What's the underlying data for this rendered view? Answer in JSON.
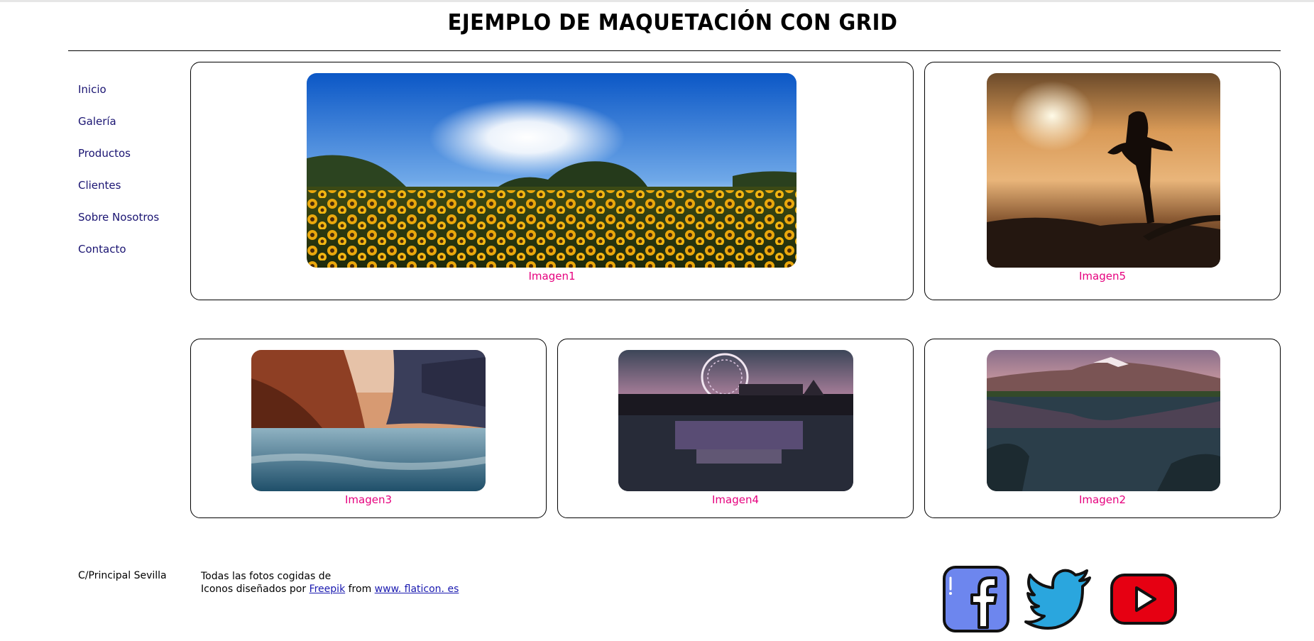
{
  "header": {
    "title": "EJEMPLO DE MAQUETACIÓN CON GRID"
  },
  "sidebar": {
    "items": [
      {
        "label": "Inicio"
      },
      {
        "label": "Galería"
      },
      {
        "label": "Productos"
      },
      {
        "label": "Clientes"
      },
      {
        "label": "Sobre Nosotros"
      },
      {
        "label": "Contacto"
      }
    ]
  },
  "gallery": {
    "caption_color": "#e6007e",
    "cards": [
      {
        "caption": "Imagen1",
        "subject": "sunflower-field"
      },
      {
        "caption": "Imagen5",
        "subject": "sunset-silhouette"
      },
      {
        "caption": "Imagen3",
        "subject": "canyon-river"
      },
      {
        "caption": "Imagen4",
        "subject": "ferris-wheel-pier"
      },
      {
        "caption": "Imagen2",
        "subject": "mountain-lake"
      }
    ]
  },
  "footer": {
    "address": "C/Principal Sevilla",
    "credits_line1": "Todas las fotos cogidas de",
    "credits_line2_prefix": "Iconos diseñados por",
    "credits_link1": "Freepik",
    "credits_mid": "from",
    "credits_link2": "www. flaticon. es",
    "social": [
      "facebook-icon",
      "twitter-icon",
      "youtube-icon"
    ]
  },
  "colors": {
    "nav_link": "#1a1472",
    "footer_link": "#1a1ab0",
    "facebook": "#6d86ee",
    "twitter": "#2aa6de",
    "youtube": "#e60012"
  }
}
